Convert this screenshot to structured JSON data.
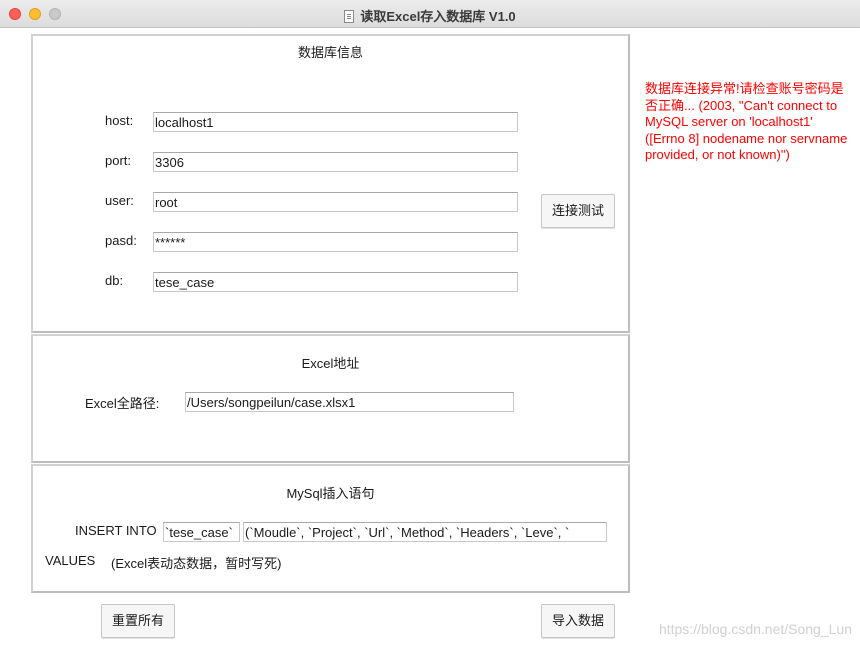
{
  "window": {
    "title": "读取Excel存入数据库 V1.0"
  },
  "db_panel": {
    "title": "数据库信息",
    "fields": [
      {
        "label": "host:",
        "value": "localhost1"
      },
      {
        "label": "port:",
        "value": "3306"
      },
      {
        "label": "user:",
        "value": "root"
      },
      {
        "label": "pasd:",
        "value": "******"
      },
      {
        "label": "db:",
        "value": "tese_case"
      }
    ],
    "test_button": "连接测试"
  },
  "excel_panel": {
    "title": "Excel地址",
    "path_label": "Excel全路径:",
    "path_value": "/Users/songpeilun/case.xlsx1"
  },
  "sql_panel": {
    "title": "MySql插入语句",
    "insert_label": "INSERT INTO",
    "table_value": "`tese_case`",
    "columns_value": "(`Moudle`, `Project`, `Url`, `Method`, `Headers`, `Leve`, `",
    "values_label": "VALUES",
    "values_note": "(Excel表动态数据，暂时写死)"
  },
  "buttons": {
    "reset": "重置所有",
    "import": "导入数据"
  },
  "error_message": "数据库连接异常!请检查账号密码是否正确... (2003, \"Can't connect to MySQL server on 'localhost1' ([Errno 8] nodename nor servname provided, or not known)\")",
  "watermark": "https://blog.csdn.net/Song_Lun",
  "colors": {
    "error": "#ff0000",
    "close": "#fe5f57",
    "minimize": "#febc2e"
  }
}
